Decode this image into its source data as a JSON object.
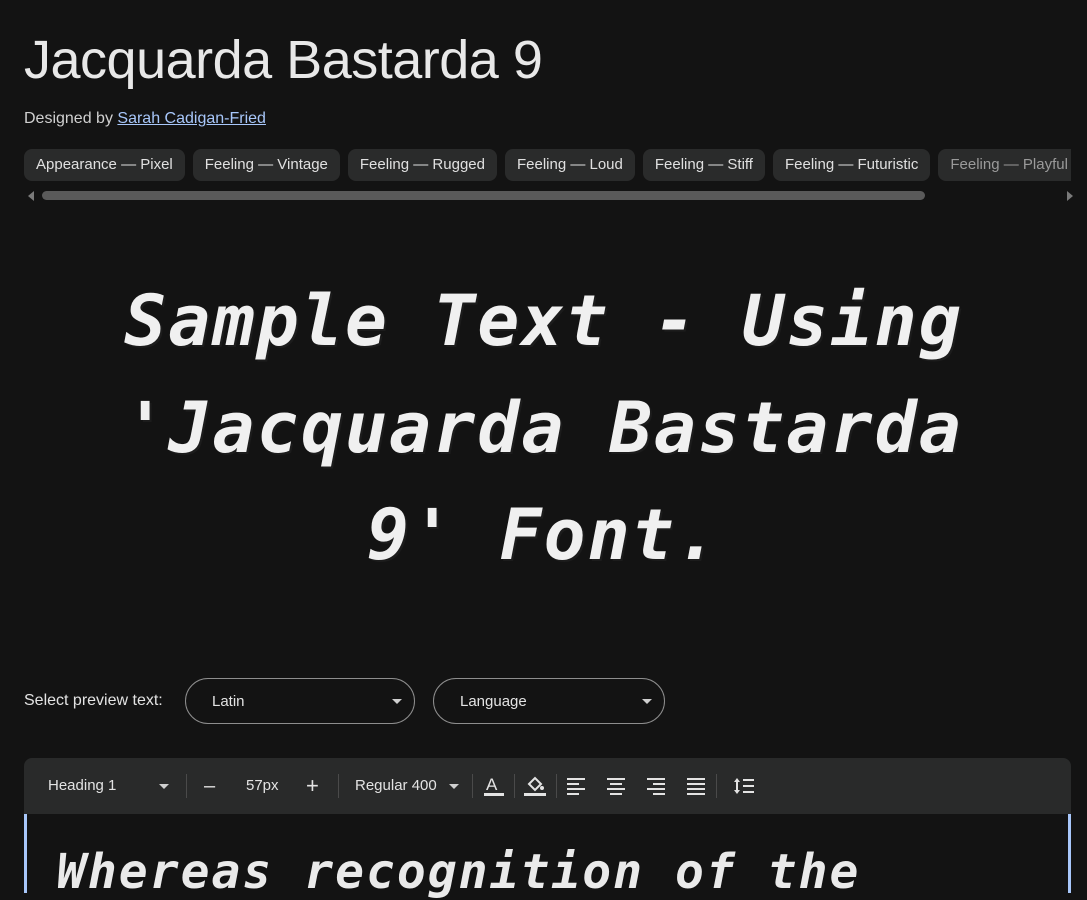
{
  "font": {
    "name": "Jacquarda Bastarda 9",
    "designed_by_prefix": "Designed by",
    "designer": "Sarah Cadigan-Fried"
  },
  "tags": [
    "Appearance — Pixel",
    "Feeling — Vintage",
    "Feeling — Rugged",
    "Feeling — Loud",
    "Feeling — Stiff",
    "Feeling — Futuristic",
    "Feeling — Playful"
  ],
  "sample_text": "Sample Text - Using 'Jacquarda Bastarda 9' Font.",
  "preview": {
    "label": "Select preview text:",
    "script_value": "Latin",
    "language_value": "Language"
  },
  "toolbar": {
    "style": "Heading 1",
    "size": "57px",
    "weight": "Regular 400",
    "minus": "–",
    "plus": "+"
  },
  "editor": {
    "text": "Whereas recognition of the"
  },
  "colors": {
    "background": "#131313",
    "link": "#a8c7fa",
    "chip": "#2a2b2b"
  }
}
